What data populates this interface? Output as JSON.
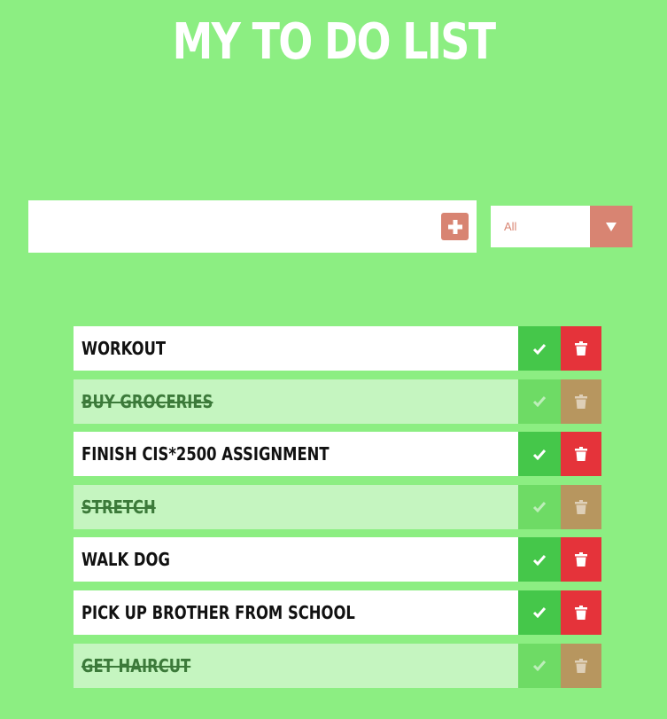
{
  "app": {
    "title": "MY TO DO LIST"
  },
  "form": {
    "input_value": "",
    "input_placeholder": "",
    "add_icon": "plus-icon"
  },
  "filter": {
    "selected": "All",
    "arrow_icon": "triangle-down-icon"
  },
  "todos": [
    {
      "text": "WORKOUT",
      "completed": false
    },
    {
      "text": "BUY GROCERIES",
      "completed": true
    },
    {
      "text": "FINISH CIS*2500 ASSIGNMENT",
      "completed": false
    },
    {
      "text": "STRETCH",
      "completed": true
    },
    {
      "text": "WALK DOG",
      "completed": false
    },
    {
      "text": "PICK UP BROTHER FROM SCHOOL",
      "completed": false
    },
    {
      "text": "GET HAIRCUT",
      "completed": true
    }
  ],
  "colors": {
    "background": "#8cee82",
    "accent": "#d88472",
    "check": "#45c74a",
    "trash": "#e5333a",
    "completed_row": "#c5f5c0",
    "completed_trash": "#b7965f"
  }
}
